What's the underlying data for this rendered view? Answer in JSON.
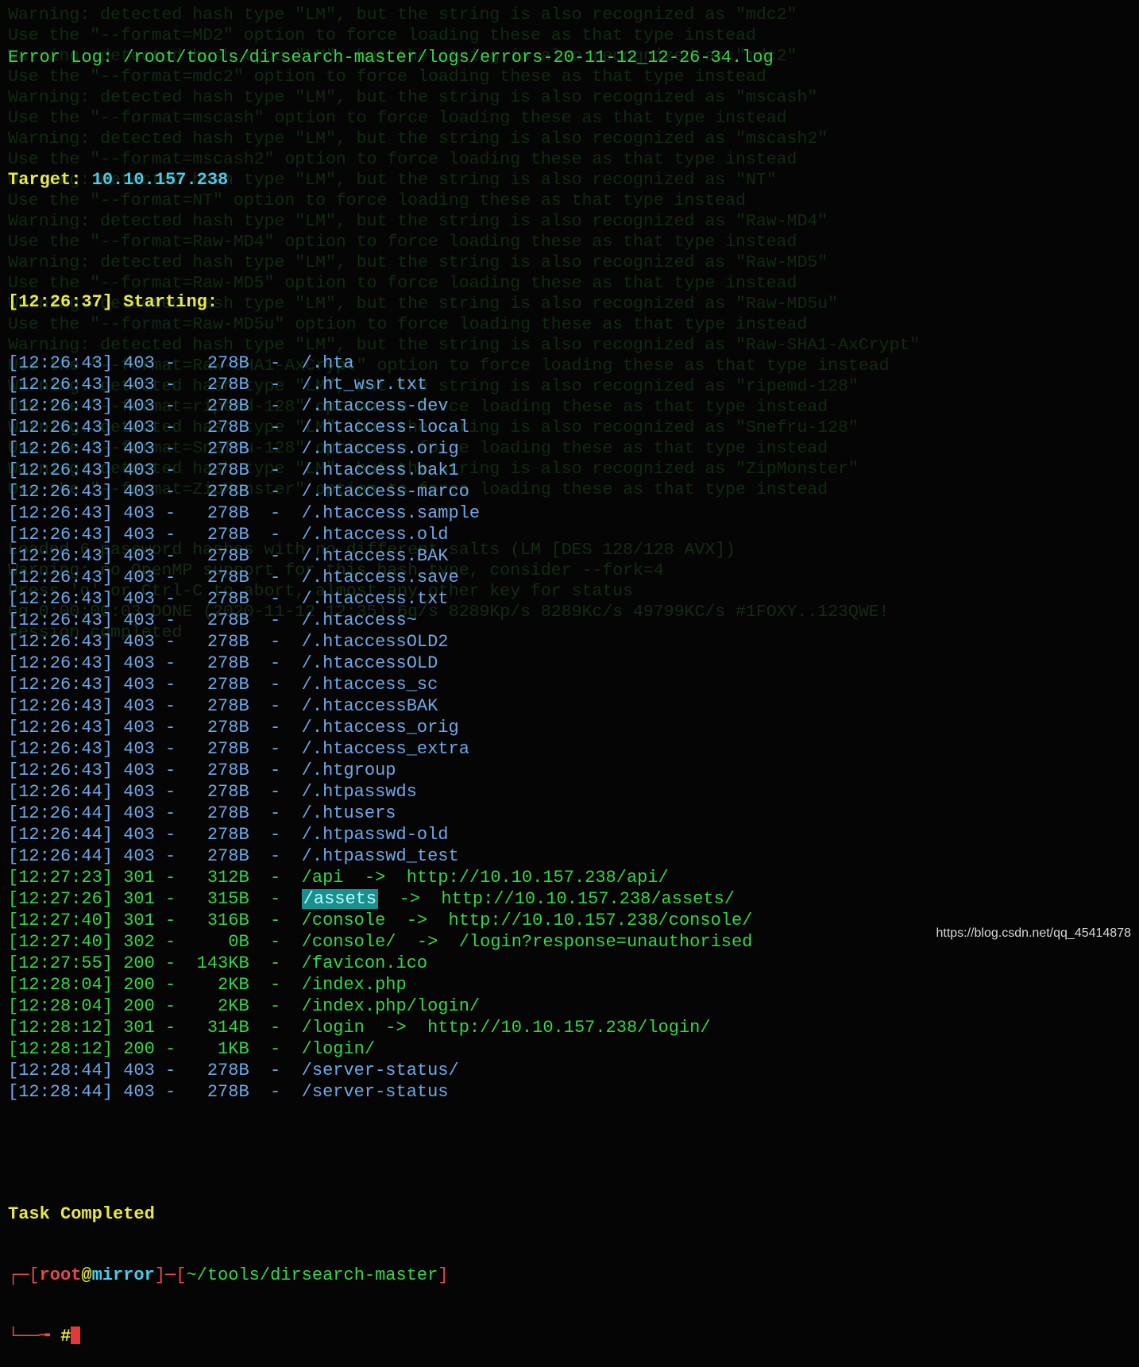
{
  "ghost_lines": [
    "Warning: detected hash type \"LM\", but the string is also recognized as \"mdc2\"",
    "Use the \"--format=MD2\" option to force loading these as that type instead",
    "Warning: detected hash type \"LM\", but the string is also recognized as \"mdc2\"",
    "Use the \"--format=mdc2\" option to force loading these as that type instead",
    "Warning: detected hash type \"LM\", but the string is also recognized as \"mscash\"",
    "Use the \"--format=mscash\" option to force loading these as that type instead",
    "Warning: detected hash type \"LM\", but the string is also recognized as \"mscash2\"",
    "Use the \"--format=mscash2\" option to force loading these as that type instead",
    "Warning: detected hash type \"LM\", but the string is also recognized as \"NT\"",
    "Use the \"--format=NT\" option to force loading these as that type instead",
    "Warning: detected hash type \"LM\", but the string is also recognized as \"Raw-MD4\"",
    "Use the \"--format=Raw-MD4\" option to force loading these as that type instead",
    "Warning: detected hash type \"LM\", but the string is also recognized as \"Raw-MD5\"",
    "Use the \"--format=Raw-MD5\" option to force loading these as that type instead",
    "Warning: detected hash type \"LM\", but the string is also recognized as \"Raw-MD5u\"",
    "Use the \"--format=Raw-MD5u\" option to force loading these as that type instead",
    "Warning: detected hash type \"LM\", but the string is also recognized as \"Raw-SHA1-AxCrypt\"",
    "Use the \"--format=Raw-SHA1-AxCrypt\" option to force loading these as that type instead",
    "Warning: detected hash type \"LM\", but the string is also recognized as \"ripemd-128\"",
    "Use the \"--format=ripemd-128\" option to force loading these as that type instead",
    "Warning: detected hash type \"LM\", but the string is also recognized as \"Snefru-128\"",
    "Use the \"--format=Snefru-128\" option to force loading these as that type instead",
    "Warning: detected hash type \"LM\", but the string is also recognized as \"ZipMonster\"",
    "Use the \"--format=ZipMonster\" option to force loading these as that type instead"
  ],
  "ghost_lines2": [
    "Loaded 6 password hashes with no different salts (LM [DES 128/128 AVX])",
    "Warning: no OpenMP support for this hash type, consider --fork=4",
    "Press 'q' or Ctrl-C to abort, almost any other key for status",
    "6g 0:00:00:03 DONE (2020-11-12 12:35) 6g/s 8289Kp/s 8289Kc/s 49799KC/s #1FOXY..123QWE!",
    "Session completed"
  ],
  "terminal": {
    "error_log_label": "Error Log:",
    "error_log_path": "/root/tools/dirsearch-master/logs/errors-20-11-12_12-26-34.log",
    "target_label": "Target:",
    "target_value": "10.10.157.238",
    "starting_time": "[12:26:37]",
    "starting_label": "Starting:",
    "results": [
      {
        "time": "[12:26:43]",
        "status": "403",
        "size": "278B",
        "path": "/.hta"
      },
      {
        "time": "[12:26:43]",
        "status": "403",
        "size": "278B",
        "path": "/.ht_wsr.txt"
      },
      {
        "time": "[12:26:43]",
        "status": "403",
        "size": "278B",
        "path": "/.htaccess-dev"
      },
      {
        "time": "[12:26:43]",
        "status": "403",
        "size": "278B",
        "path": "/.htaccess-local"
      },
      {
        "time": "[12:26:43]",
        "status": "403",
        "size": "278B",
        "path": "/.htaccess.orig"
      },
      {
        "time": "[12:26:43]",
        "status": "403",
        "size": "278B",
        "path": "/.htaccess.bak1"
      },
      {
        "time": "[12:26:43]",
        "status": "403",
        "size": "278B",
        "path": "/.htaccess-marco"
      },
      {
        "time": "[12:26:43]",
        "status": "403",
        "size": "278B",
        "path": "/.htaccess.sample"
      },
      {
        "time": "[12:26:43]",
        "status": "403",
        "size": "278B",
        "path": "/.htaccess.old"
      },
      {
        "time": "[12:26:43]",
        "status": "403",
        "size": "278B",
        "path": "/.htaccess.BAK"
      },
      {
        "time": "[12:26:43]",
        "status": "403",
        "size": "278B",
        "path": "/.htaccess.save"
      },
      {
        "time": "[12:26:43]",
        "status": "403",
        "size": "278B",
        "path": "/.htaccess.txt"
      },
      {
        "time": "[12:26:43]",
        "status": "403",
        "size": "278B",
        "path": "/.htaccess~"
      },
      {
        "time": "[12:26:43]",
        "status": "403",
        "size": "278B",
        "path": "/.htaccessOLD2"
      },
      {
        "time": "[12:26:43]",
        "status": "403",
        "size": "278B",
        "path": "/.htaccessOLD"
      },
      {
        "time": "[12:26:43]",
        "status": "403",
        "size": "278B",
        "path": "/.htaccess_sc"
      },
      {
        "time": "[12:26:43]",
        "status": "403",
        "size": "278B",
        "path": "/.htaccessBAK"
      },
      {
        "time": "[12:26:43]",
        "status": "403",
        "size": "278B",
        "path": "/.htaccess_orig"
      },
      {
        "time": "[12:26:43]",
        "status": "403",
        "size": "278B",
        "path": "/.htaccess_extra"
      },
      {
        "time": "[12:26:43]",
        "status": "403",
        "size": "278B",
        "path": "/.htgroup"
      },
      {
        "time": "[12:26:44]",
        "status": "403",
        "size": "278B",
        "path": "/.htpasswds"
      },
      {
        "time": "[12:26:44]",
        "status": "403",
        "size": "278B",
        "path": "/.htusers"
      },
      {
        "time": "[12:26:44]",
        "status": "403",
        "size": "278B",
        "path": "/.htpasswd-old"
      },
      {
        "time": "[12:26:44]",
        "status": "403",
        "size": "278B",
        "path": "/.htpasswd_test"
      },
      {
        "time": "[12:27:23]",
        "status": "301",
        "size": "312B",
        "path": "/api",
        "redirect": "http://10.10.157.238/api/"
      },
      {
        "time": "[12:27:26]",
        "status": "301",
        "size": "315B",
        "path": "/assets",
        "redirect": "http://10.10.157.238/assets/",
        "selected": true
      },
      {
        "time": "[12:27:40]",
        "status": "301",
        "size": "316B",
        "path": "/console",
        "redirect": "http://10.10.157.238/console/"
      },
      {
        "time": "[12:27:40]",
        "status": "302",
        "size": "0B",
        "path": "/console/",
        "redirect": "/login?response=unauthorised"
      },
      {
        "time": "[12:27:55]",
        "status": "200",
        "size": "143KB",
        "path": "/favicon.ico"
      },
      {
        "time": "[12:28:04]",
        "status": "200",
        "size": "2KB",
        "path": "/index.php"
      },
      {
        "time": "[12:28:04]",
        "status": "200",
        "size": "2KB",
        "path": "/index.php/login/"
      },
      {
        "time": "[12:28:12]",
        "status": "301",
        "size": "314B",
        "path": "/login",
        "redirect": "http://10.10.157.238/login/"
      },
      {
        "time": "[12:28:12]",
        "status": "200",
        "size": "1KB",
        "path": "/login/"
      },
      {
        "time": "[12:28:44]",
        "status": "403",
        "size": "278B",
        "path": "/server-status/"
      },
      {
        "time": "[12:28:44]",
        "status": "403",
        "size": "278B",
        "path": "/server-status"
      }
    ],
    "task_completed": "Task Completed",
    "prompt": {
      "user": "root",
      "at": "@",
      "host": "mirror",
      "cwd": "~/tools/dirsearch-master",
      "symbol": "#"
    }
  },
  "watermark": "https://blog.csdn.net/qq_45414878",
  "colors": {
    "background": "#050505",
    "yellow": "#e8e84a",
    "cyan": "#4fc9e6",
    "green": "#37d44a",
    "blue": "#6fa8e8",
    "red": "#e24a4a",
    "selection": "#1a8f8f"
  }
}
